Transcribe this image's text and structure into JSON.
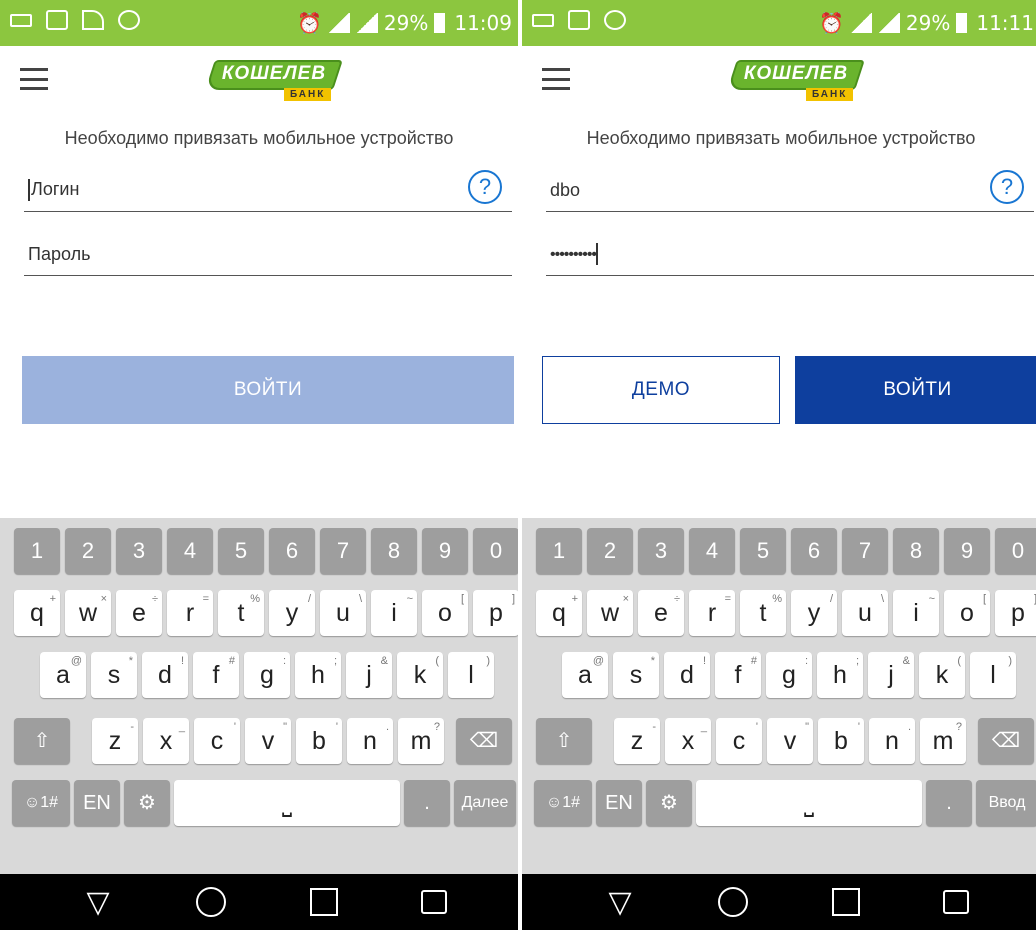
{
  "status_left": {
    "time": "11:09",
    "battery": "29%"
  },
  "status_right": {
    "time": "11:11",
    "battery": "29%"
  },
  "logo": {
    "name": "КОШЕЛЕВ",
    "sub": "БАНК"
  },
  "notice": "Необходимо привязать мобильное устройство",
  "screen1": {
    "login_placeholder": "Логин",
    "password_placeholder": "Пароль",
    "login_button": "ВОЙТИ",
    "enter_key": "Далее"
  },
  "screen2": {
    "login_value": "dbo",
    "password_value": "••••••••••",
    "demo_button": "ДЕМО",
    "login_button": "ВОЙТИ",
    "enter_key": "Ввод"
  },
  "keyboard": {
    "numbers": [
      "1",
      "2",
      "3",
      "4",
      "5",
      "6",
      "7",
      "8",
      "9",
      "0"
    ],
    "row1": [
      "q",
      "w",
      "e",
      "r",
      "t",
      "y",
      "u",
      "i",
      "o",
      "p"
    ],
    "row1_alt": [
      "+",
      "×",
      "÷",
      "=",
      "%",
      "/",
      "\\",
      "~",
      "[",
      "]"
    ],
    "row2": [
      "a",
      "s",
      "d",
      "f",
      "g",
      "h",
      "j",
      "k",
      "l"
    ],
    "row2_alt": [
      "@",
      "*",
      "!",
      "#",
      ":",
      ";",
      "&",
      "(",
      ")"
    ],
    "row3": [
      "z",
      "x",
      "c",
      "v",
      "b",
      "n",
      "m"
    ],
    "row3_alt": [
      "-",
      "_",
      "'",
      "\"",
      "'",
      ".",
      "?"
    ],
    "symbols_key": "☺1#",
    "lang_key": "EN",
    "period_key": "."
  },
  "colors": {
    "status_bar": "#8cc63f",
    "primary": "#0e3f9e",
    "disabled": "#9bb2dd",
    "help": "#1976d2"
  }
}
